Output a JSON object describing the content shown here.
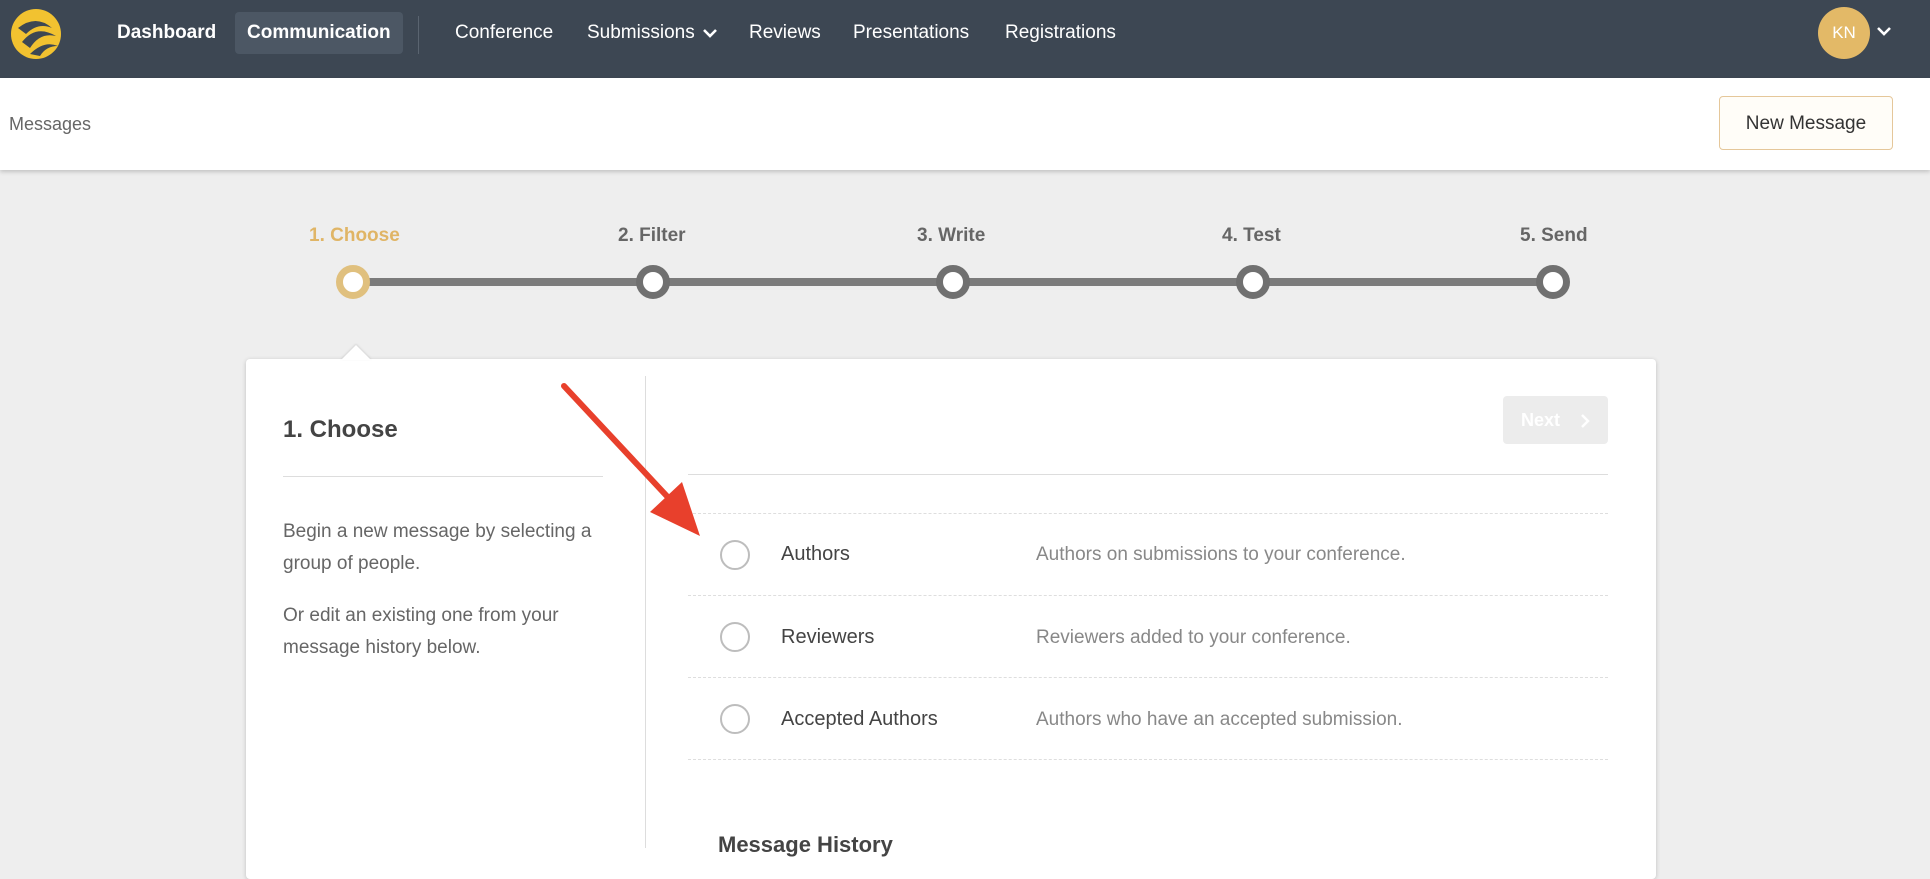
{
  "nav": {
    "items": [
      {
        "label": "Dashboard"
      },
      {
        "label": "Communication"
      },
      {
        "label": "Conference"
      },
      {
        "label": "Submissions"
      },
      {
        "label": "Reviews"
      },
      {
        "label": "Presentations"
      },
      {
        "label": "Registrations"
      }
    ],
    "avatar_initials": "KN"
  },
  "subheader": {
    "breadcrumb": "Messages",
    "new_message_label": "New Message"
  },
  "stepper": {
    "steps": [
      {
        "label": "1. Choose",
        "active": true
      },
      {
        "label": "2. Filter",
        "active": false
      },
      {
        "label": "3. Write",
        "active": false
      },
      {
        "label": "4. Test",
        "active": false
      },
      {
        "label": "5. Send",
        "active": false
      }
    ]
  },
  "panel": {
    "title": "1. Choose",
    "desc1": "Begin a new message by selecting a group of people.",
    "desc2": "Or edit an existing one from your message history below."
  },
  "main": {
    "next_label": "Next",
    "options": [
      {
        "name": "Authors",
        "description": "Authors on submissions to your conference."
      },
      {
        "name": "Reviewers",
        "description": "Reviewers added to your conference."
      },
      {
        "name": "Accepted Authors",
        "description": "Authors who have an accepted submission."
      }
    ],
    "history_title": "Message History"
  },
  "colors": {
    "nav_bg": "#3d4753",
    "accent": "#e0b566",
    "annotation_arrow": "#e8402c"
  }
}
